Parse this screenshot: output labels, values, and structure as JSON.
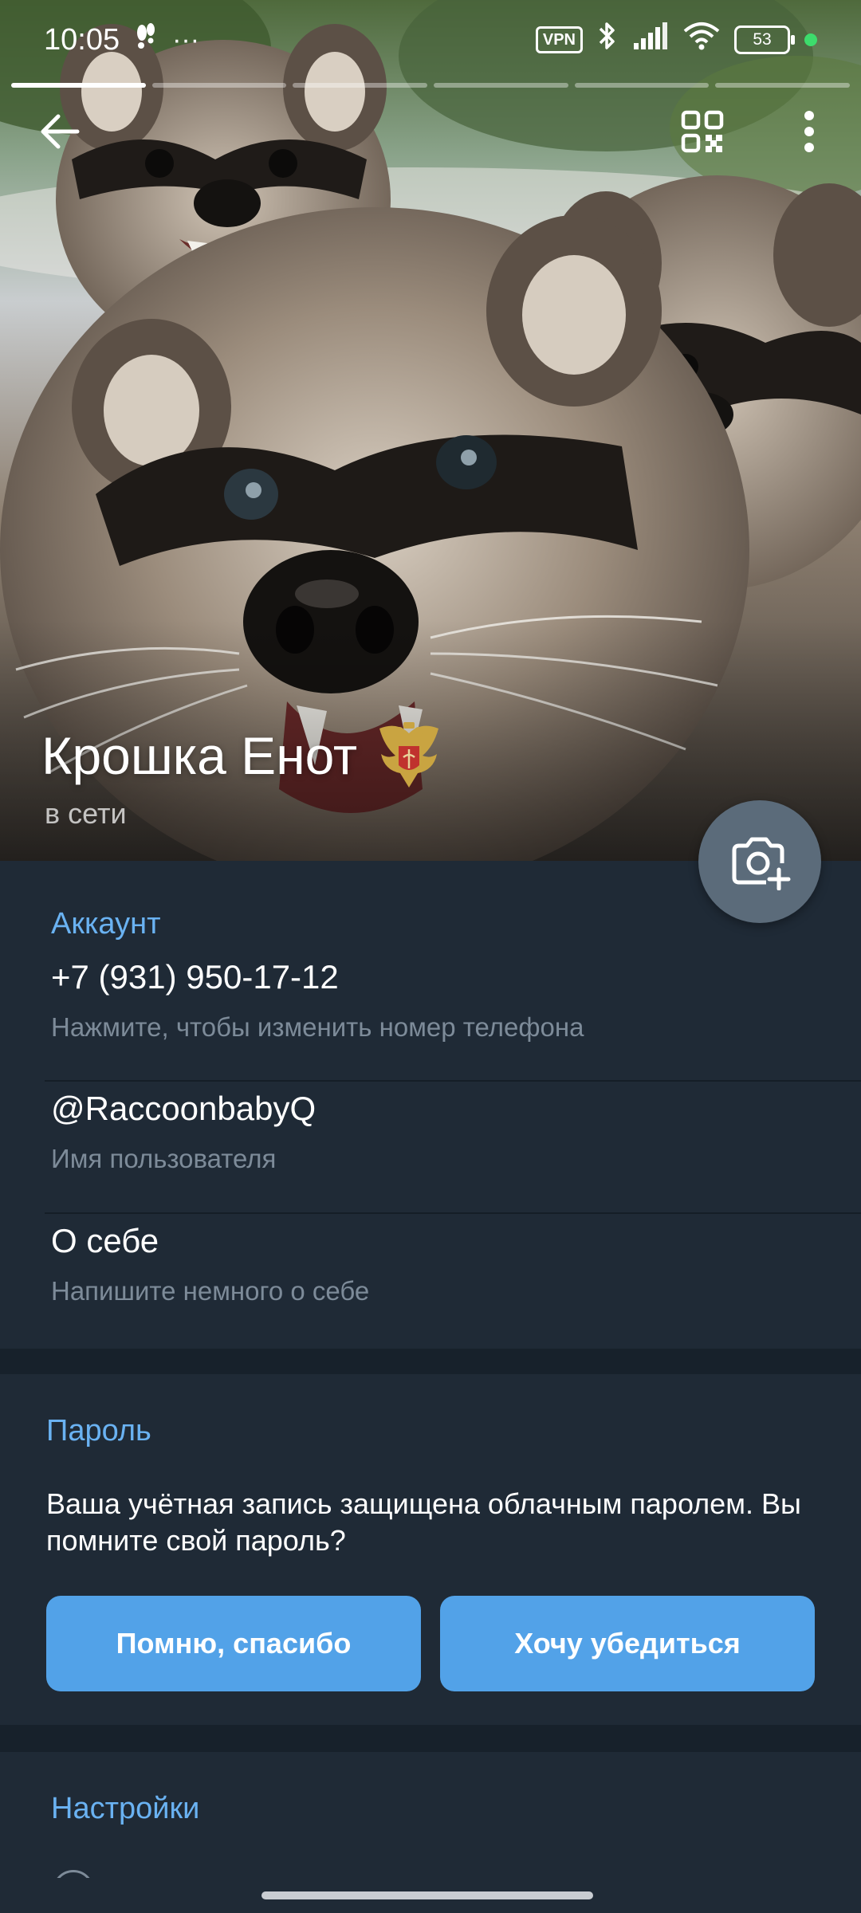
{
  "status_bar": {
    "time": "10:05",
    "overflow_dots": "···",
    "vpn": "VPN",
    "battery": "53"
  },
  "story_progress": {
    "segments": 6,
    "active_index": 0
  },
  "profile": {
    "name": "Крошка Енот",
    "status": "в сети"
  },
  "account": {
    "title": "Аккаунт",
    "phone": "+7 (931) 950-17-12",
    "phone_hint": "Нажмите, чтобы изменить номер телефона",
    "username": "@RaccoonbabyQ",
    "username_hint": "Имя пользователя",
    "bio": "О себе",
    "bio_hint": "Напишите немного о себе"
  },
  "password": {
    "title": "Пароль",
    "text": "Ваша учётная запись защищена облачным паролем. Вы помните свой пароль?",
    "remember_button": "Помню, спасибо",
    "verify_button": "Хочу убедиться"
  },
  "settings": {
    "title": "Настройки"
  },
  "colors": {
    "accent": "#6ab2f2",
    "button": "#52a2e8",
    "background": "#1f2a36",
    "gap": "#17212b",
    "secondary_text": "#7d8b99"
  },
  "icons": [
    "back-arrow-icon",
    "qr-code-icon",
    "more-vert-icon",
    "add-photo-icon",
    "bluetooth-icon",
    "signal-icon",
    "wifi-icon",
    "walking-icon"
  ]
}
